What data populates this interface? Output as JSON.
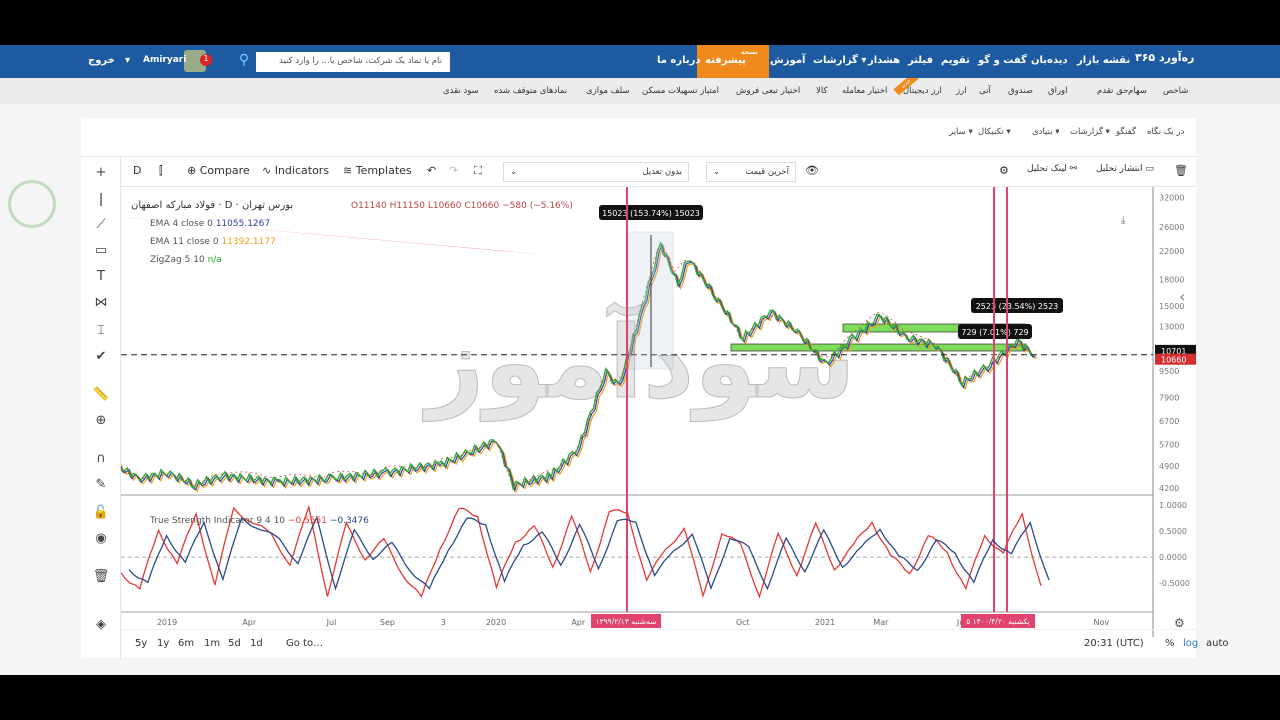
{
  "nav": {
    "logo": "ره‌آورد ۳۶۵",
    "items": [
      "نقشه بازار",
      "دیده‌بان",
      "گفت و گو",
      "تقویم",
      "فیلتر",
      "هشدار",
      "گزارشات ▾",
      "آموزش"
    ],
    "advanced": "پیشرفته",
    "advanced_badge": "نسخه",
    "about": "درباره ما",
    "search_placeholder": "نام یا نماد یک شرکت، شاخص یا... را وارد کنید",
    "user": "Amiryari",
    "notif_count": "1",
    "logout": "خروج"
  },
  "subnav": [
    "شاخص",
    "سهام",
    "حق تقدم",
    "اوراق",
    "صندوق",
    "آتی",
    "ارز",
    "ارز دیجیتال",
    "اختیار معامله",
    "کالا",
    "اختیار تبعی فروش",
    "امتیاز تسهیلات مسکن",
    "سلف موازی",
    "نمادهای متوقف شده",
    "سود نقدی"
  ],
  "subnav_badge": "جدید",
  "tabs": [
    "در یک نگاه",
    "گفتگو",
    "گزارشات ▾",
    "بنیادی ▾",
    "تکنیکال ▾",
    "سایر ▾"
  ],
  "toolbar": {
    "interval": "D",
    "compare": "Compare",
    "indicators": "Indicators",
    "templates": "Templates",
    "adjust": "بدون تعدیل",
    "price_type": "آخرین قیمت",
    "link": "لینک تحلیل",
    "publish": "انتشار تحلیل"
  },
  "legend": {
    "title": "فولاد مبارکه اصفهان · D · بورس تهران",
    "ohlc": "O11140 H11150 L10660 C10660 −580 (−5.16%)",
    "ema4": "EMA 4 close 0",
    "ema4_val": "11055.1267",
    "ema11": "EMA 11 close 0",
    "ema11_val": "11392.1177",
    "zigzag": "ZigZag 5 10",
    "zigzag_val": "n/a",
    "tsi": "True Strength Indicator 9 4 10",
    "tsi_v1": "−0.5551",
    "tsi_v2": "−0.3476"
  },
  "annotations": {
    "measure1": "15023 (153.74%) 15023",
    "measure2": "2523 (23.54%) 2523",
    "measure3": "729 (7.01%) 729",
    "last_price": "10701",
    "close_price": "10660",
    "date1": "سه‌شنبه ۱۳۹۹/۲/۱۳",
    "date2": "۵ یکشنبه ۱۴۰۰/۴/۲۰"
  },
  "watermark": "سودآموز",
  "colors": {
    "nav": "#1e5aa0",
    "accent": "#f08a1c",
    "ema4": "#2b3fb0",
    "ema11": "#f39c12",
    "tsi": "#e53935",
    "tsi_signal": "#2a4a8a",
    "cursor": "#e0446e",
    "zone": "#7ddc5a"
  },
  "chart_data": {
    "type": "line",
    "yscale": "log",
    "price_ticks": [
      32000,
      26000,
      22000,
      18000,
      15000,
      13000,
      9500,
      7900,
      6700,
      5700,
      4900,
      4200
    ],
    "tsi_ticks": [
      "1.0000",
      "0.5000",
      "0.0000",
      "-0.5000"
    ],
    "time_ticks": [
      "2019",
      "Apr",
      "Jul",
      "Sep",
      "3",
      "2020",
      "Apr",
      "Oct",
      "2021",
      "Mar",
      "Jun",
      "Nov"
    ],
    "price": [
      [
        "2018-11",
        5000
      ],
      [
        "2018-12",
        4500
      ],
      [
        "2019-01",
        4700
      ],
      [
        "2019-02",
        4300
      ],
      [
        "2019-03",
        4600
      ],
      [
        "2019-05",
        4400
      ],
      [
        "2019-07",
        4500
      ],
      [
        "2019-09",
        4700
      ],
      [
        "2019-11",
        5000
      ],
      [
        "2019-12",
        5400
      ],
      [
        "2020-01",
        5900
      ],
      [
        "2020-01-20",
        4300
      ],
      [
        "2020-03",
        4600
      ],
      [
        "2020-04",
        5600
      ],
      [
        "2020-05",
        9500
      ],
      [
        "2020-05-15",
        8500
      ],
      [
        "2020-06",
        12000
      ],
      [
        "2020-07",
        23000
      ],
      [
        "2020-07-20",
        17500
      ],
      [
        "2020-08",
        21000
      ],
      [
        "2020-09",
        16000
      ],
      [
        "2020-10",
        12000
      ],
      [
        "2020-11",
        14500
      ],
      [
        "2020-12",
        12500
      ],
      [
        "2021-01",
        10000
      ],
      [
        "2021-02",
        12000
      ],
      [
        "2021-03",
        14000
      ],
      [
        "2021-04",
        12000
      ],
      [
        "2021-05",
        11500
      ],
      [
        "2021-06",
        8800
      ],
      [
        "2021-07",
        10000
      ],
      [
        "2021-08",
        11800
      ],
      [
        "2021-08-20",
        10660
      ]
    ],
    "tsi": [
      -0.3,
      -0.6,
      0.5,
      -0.1,
      0.8,
      -0.5,
      0.9,
      0.7,
      0.4,
      -0.1,
      0.9,
      -0.7,
      0.6,
      0,
      0.3,
      -0.3,
      -0.8,
      0.2,
      0.9,
      0.8,
      -0.6,
      0.3,
      0.6,
      -0.2,
      0.8,
      -0.3,
      0.9,
      0.8,
      -0.4,
      0.1,
      0.6,
      -0.8,
      0.5,
      0.2,
      -0.7,
      0.4,
      -0.3,
      0.6,
      -0.2,
      0.2,
      0.7,
      0,
      -0.3,
      0.4,
      0.1,
      -0.6,
      0.4,
      0.1,
      0.8,
      -0.55
    ]
  }
}
